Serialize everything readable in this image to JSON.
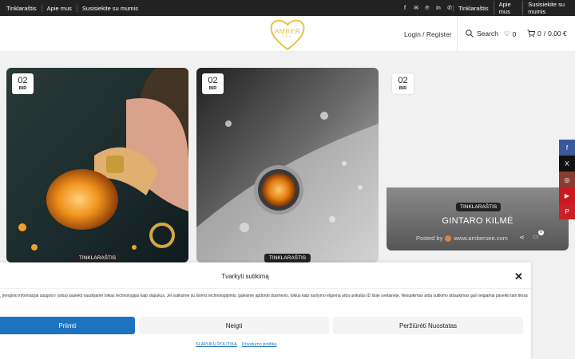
{
  "topbar": {
    "left_links": [
      "Tinklaraštis",
      "Apie mus",
      "Susisiekite su mumis"
    ],
    "social_icons": [
      "facebook-icon",
      "email-icon",
      "pinterest-icon",
      "linkedin-icon",
      "whatsapp-icon"
    ],
    "right_links": [
      "Tinklaraštis",
      "Apie mus",
      "Susisiekite su mumis"
    ]
  },
  "header": {
    "logo_text": "AMBER",
    "logo_sub": "SEE",
    "login_label": "Login / Register",
    "search_label": "Search",
    "wishlist_count": "0",
    "cart_count": "0",
    "cart_total": "0,00 €"
  },
  "posts": [
    {
      "day": "02",
      "month": "BIR",
      "category": "TINKLARAŠTIS"
    },
    {
      "day": "02",
      "month": "BIR",
      "category": "TINKLARAŠTIS"
    },
    {
      "day": "02",
      "month": "BIR",
      "category": "TINKLARAŠTIS",
      "title": "GINTARO KILMĖ",
      "posted_by": "Posted by",
      "author": "www.ambersee.com",
      "comments": "0"
    }
  ],
  "share_sidebar": [
    "facebook-icon",
    "x-icon",
    "instagram-icon",
    "youtube-icon",
    "pinterest-icon"
  ],
  "colors": {
    "accent": "#1e73be",
    "logo": "#e8c243",
    "facebook": "#3b5998",
    "x": "#111111",
    "instagram": "#8a3b2f",
    "youtube": "#cc181e",
    "pinterest": "#cb2027"
  },
  "consent": {
    "title": "Tvarkyti sutikimą",
    "text": ", įrenginio informacijai saugoti ir (arba) pasiekti naudojame tokias technologijas kaip slapukus. Jei sutiksime su šiomis technologijomis, galėsime apdoroti duomenis, tokius kaip naršymo elgsena arba unikalūs ID šioje svetainėje. Nesutikimas arba sutikimo atšaukimas gali neigiamai paveikti tam tikras",
    "accept_label": "Priimti",
    "deny_label": "Neigti",
    "prefs_label": "Peržiūrėti Nuostatas",
    "cookie_policy": "SLAPUKŲ POLITIKA",
    "privacy_policy": "Privatumo politika"
  }
}
